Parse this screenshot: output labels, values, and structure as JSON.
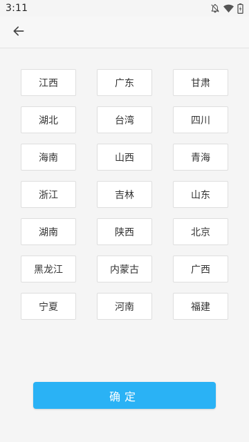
{
  "status_bar": {
    "time": "3:11",
    "icons": [
      "notifications-off-icon",
      "wifi-icon",
      "battery-charging-icon"
    ]
  },
  "app_bar": {
    "back_icon": "arrow-left-icon"
  },
  "provinces": [
    "江西",
    "广东",
    "甘肃",
    "湖北",
    "台湾",
    "四川",
    "海南",
    "山西",
    "青海",
    "浙江",
    "吉林",
    "山东",
    "湖南",
    "陕西",
    "北京",
    "黑龙江",
    "内蒙古",
    "广西",
    "宁夏",
    "河南",
    "福建"
  ],
  "confirm_button": {
    "label": "确定",
    "color": "#2ab2f5"
  }
}
